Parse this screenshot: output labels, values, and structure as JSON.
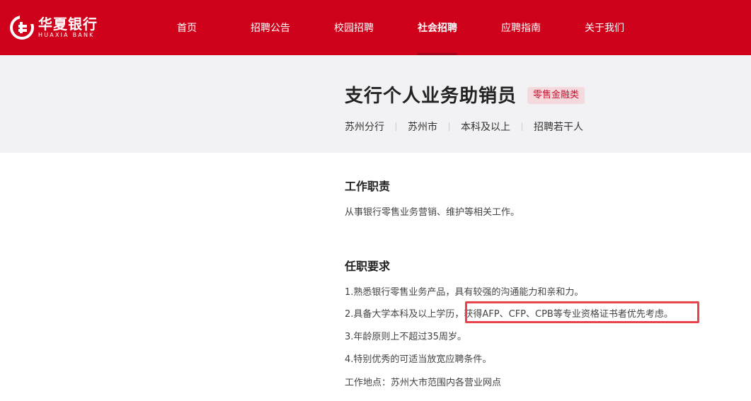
{
  "header": {
    "brand_cn": "华夏银行",
    "brand_en": "HUAXIA BANK",
    "nav": [
      {
        "label": "首页"
      },
      {
        "label": "招聘公告"
      },
      {
        "label": "校园招聘"
      },
      {
        "label": "社会招聘",
        "active": true
      },
      {
        "label": "应聘指南"
      },
      {
        "label": "关于我们"
      }
    ]
  },
  "job": {
    "title": "支行个人业务助销员",
    "tag": "零售金融类",
    "meta": [
      "苏州分行",
      "苏州市",
      "本科及以上",
      "招聘若干人"
    ]
  },
  "duties": {
    "heading": "工作职责",
    "text": "从事银行零售业务营销、维护等相关工作。"
  },
  "requirements": {
    "heading": "任职要求",
    "items": [
      "1.熟悉银行零售业务产品，具有较强的沟通能力和亲和力。",
      "2.具备大学本科及以上学历，获得AFP、CFP、CPB等专业资格证书者优先考虑。",
      "3.年龄原则上不超过35周岁。",
      "4.特别优秀的可适当放宽应聘条件。"
    ],
    "location": "工作地点：苏州大市范围内各营业网点"
  },
  "colors": {
    "brand_red": "#d0021b",
    "tag_text": "#c8102e",
    "highlight": "#e8424b"
  }
}
